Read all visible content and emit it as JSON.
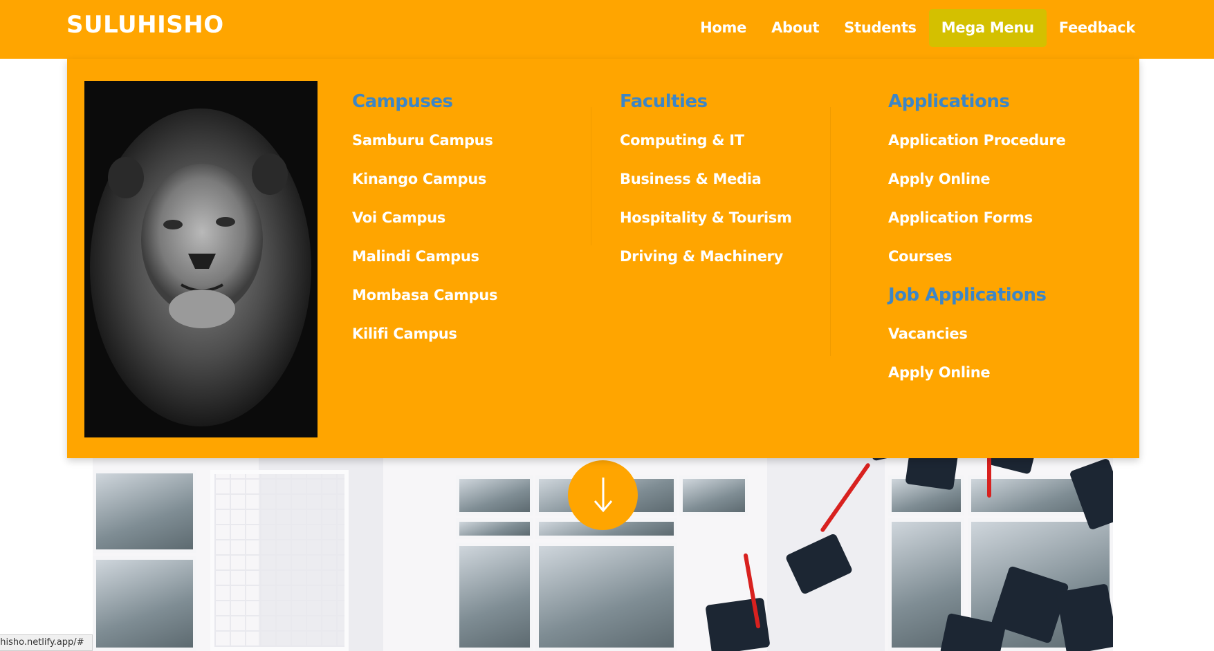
{
  "brand": {
    "logo": "SULUHISHO",
    "accent": "#ffa500",
    "active_nav_bg": "#d4c000",
    "heading_color": "#3d86c6"
  },
  "nav": {
    "items": [
      {
        "label": "Home"
      },
      {
        "label": "About"
      },
      {
        "label": "Students"
      },
      {
        "label": "Mega Menu",
        "active": true
      },
      {
        "label": "Feedback"
      }
    ]
  },
  "mega_menu": {
    "image": "lion-portrait-black-and-white",
    "columns": [
      {
        "heading": "Campuses",
        "links": [
          "Samburu Campus",
          "Kinango Campus",
          "Voi Campus",
          "Malindi Campus",
          "Mombasa Campus",
          "Kilifi Campus"
        ]
      },
      {
        "heading": "Faculties",
        "links": [
          "Computing & IT",
          "Business & Media",
          "Hospitality & Tourism",
          "Driving & Machinery"
        ]
      },
      {
        "heading": "Applications",
        "links": [
          "Application Procedure",
          "Apply Online",
          "Application Forms",
          "Courses"
        ],
        "sub_heading": "Job Applications",
        "sub_links": [
          "Vacancies",
          "Apply Online"
        ]
      }
    ]
  },
  "hero": {
    "image": "graduation-caps-thrown-in-front-of-building",
    "scroll_icon": "arrow-down-icon"
  },
  "status_bar": {
    "url": "uhisho.netlify.app/#"
  }
}
